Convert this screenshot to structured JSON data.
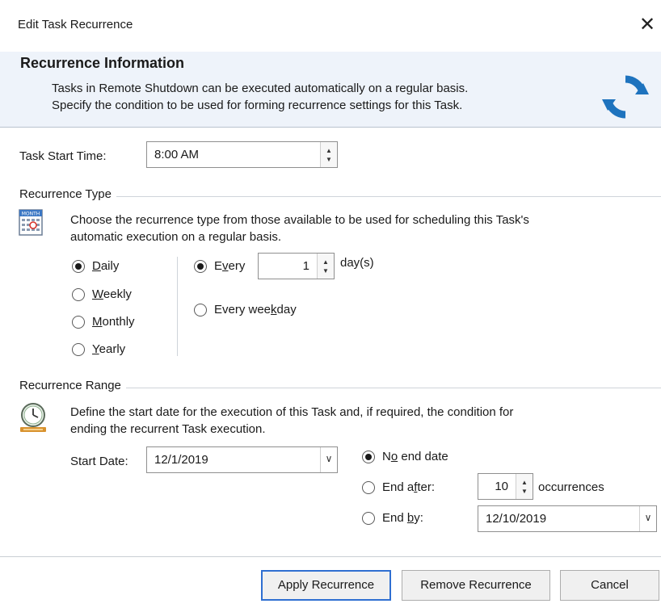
{
  "window": {
    "title": "Edit Task Recurrence",
    "close_glyph": "✕"
  },
  "header": {
    "title": "Recurrence Information",
    "desc_line1": "Tasks in Remote Shutdown can be executed automatically on a regular basis.",
    "desc_line2": "Specify the condition to be used for forming recurrence settings for this Task.",
    "icon": "refresh-icon"
  },
  "start_time": {
    "label": "Task Start Time:",
    "value": "8:00 AM"
  },
  "recurrence_type": {
    "group_title": "Recurrence Type",
    "desc_line1": "Choose the recurrence type from those available to be used for scheduling this Task's",
    "desc_line2": "automatic execution on a regular basis.",
    "icon": "calendar-icon",
    "icon_text": "MONTH",
    "options": [
      {
        "pre": "",
        "key": "D",
        "post": "aily",
        "selected": true
      },
      {
        "pre": "",
        "key": "W",
        "post": "eekly",
        "selected": false
      },
      {
        "pre": "",
        "key": "M",
        "post": "onthly",
        "selected": false
      },
      {
        "pre": "",
        "key": "Y",
        "post": "early",
        "selected": false
      }
    ],
    "every": {
      "pre": "E",
      "key": "v",
      "post": "ery",
      "value": "1",
      "unit": "day(s)",
      "selected": true
    },
    "weekday": {
      "pre": "Every wee",
      "key": "k",
      "post": "day",
      "selected": false
    }
  },
  "recurrence_range": {
    "group_title": "Recurrence Range",
    "desc_line1": "Define the start date for the execution of this Task and, if required, the condition for",
    "desc_line2": "ending the recurrent Task execution.",
    "icon": "clock-icon",
    "start_date": {
      "label": "Start Date:",
      "value": "12/1/2019"
    },
    "no_end": {
      "pre": "N",
      "key": "o",
      "post": " end date",
      "selected": true
    },
    "end_after": {
      "pre": "End a",
      "key": "f",
      "post": "ter:",
      "value": "10",
      "unit": "occurrences",
      "selected": false
    },
    "end_by": {
      "pre": "End ",
      "key": "b",
      "post": "y:",
      "value": "12/10/2019",
      "selected": false
    }
  },
  "buttons": {
    "apply": "Apply Recurrence",
    "remove": "Remove Recurrence",
    "cancel": "Cancel"
  },
  "colors": {
    "header_bg": "#eef3fa",
    "accent": "#2f6fd1",
    "icon_blue": "#1e73be"
  }
}
